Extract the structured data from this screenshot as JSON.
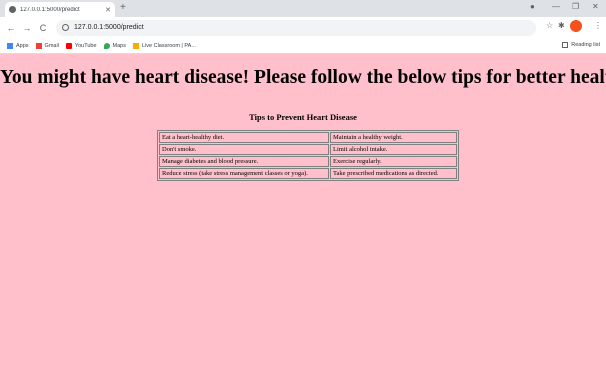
{
  "browser": {
    "tab_title": "127.0.0.1:5000/predict",
    "tab_close": "✕",
    "new_tab": "+",
    "url": "127.0.0.1:5000/predict",
    "bookmarks": [
      {
        "label": "Apps",
        "icon": "apps-grid-icon",
        "color": "#4285f4"
      },
      {
        "label": "Gmail",
        "icon": "gmail-icon",
        "color": "#ea4335"
      },
      {
        "label": "YouTube",
        "icon": "youtube-icon",
        "color": "#ff0000"
      },
      {
        "label": "Maps",
        "icon": "maps-pin-icon",
        "color": "#34a853"
      },
      {
        "label": "Live Classroom | PA...",
        "icon": "classroom-icon",
        "color": "#f9ab00"
      }
    ],
    "reading_list": "Reading list"
  },
  "page": {
    "headline": "You might have heart disease! Please follow the below tips for better health.",
    "tips_title": "Tips to Prevent Heart Disease",
    "tips_rows": [
      [
        "Eat a heart-healthy diet.",
        "Maintain a healthy weight."
      ],
      [
        "Don't smoke.",
        "Limit alcohol intake."
      ],
      [
        "Manage diabetes and blood pressure.",
        "Exercise regularly."
      ],
      [
        "Reduce stress (take stress management classes or yoga).",
        "Take prescribed medications as directed."
      ]
    ],
    "background": "#ffc0cb"
  }
}
